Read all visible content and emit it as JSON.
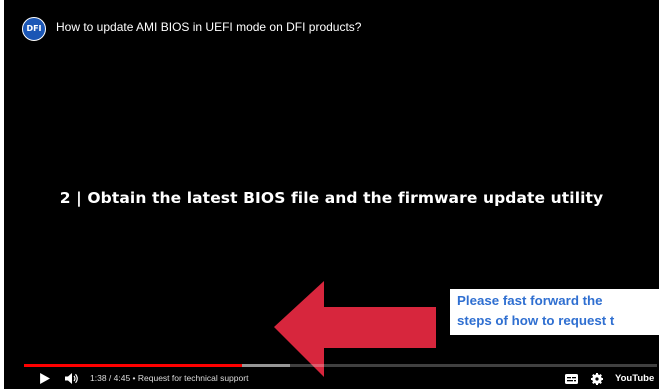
{
  "video": {
    "channel_logo_text": "DFI",
    "title": "How to update AMI BIOS in UEFI mode on DFI products?",
    "slide_text": "2 | Obtain the latest BIOS file and the firmware update utility"
  },
  "overlay": {
    "line1": "Please fast forward the",
    "line2": "steps of how to request t",
    "color": "#2f6fd1"
  },
  "player": {
    "current_time": "1:38",
    "duration": "4:45",
    "chapter": "Request for technical support",
    "time_text": "1:38 / 4:45 • Request for technical support",
    "brand": "YouTube",
    "played_fraction": 0.344,
    "progress_color": "#ff0000",
    "arrow_color": "#d7263d"
  },
  "icons": {
    "play": "play-icon",
    "volume": "volume-icon",
    "captions": "captions-icon",
    "settings": "settings-icon"
  }
}
